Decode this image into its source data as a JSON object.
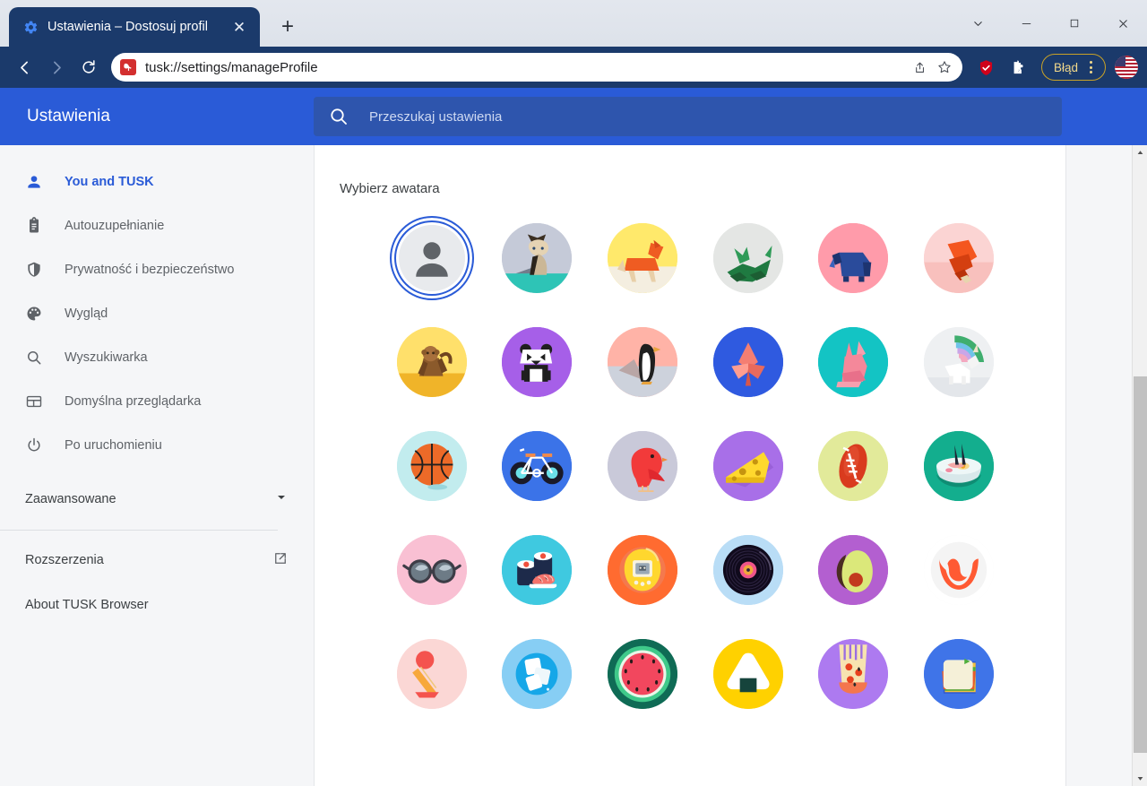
{
  "browser": {
    "tab": {
      "title": "Ustawienia – Dostosuj profil",
      "favicon": "gear-icon",
      "close_label": "✕"
    },
    "newtab_label": "+",
    "window_controls": {
      "more": "⌄",
      "minimize": "—",
      "maximize": "□",
      "close": "✕"
    },
    "toolbar": {
      "back": "back-arrow-icon",
      "forward": "forward-arrow-icon",
      "reload": "reload-icon",
      "url": "tusk://settings/manageProfile",
      "site_icon": "tusk-logo-icon",
      "share": "share-icon",
      "bookmark": "star-icon",
      "shield": "shield-icon",
      "extensions": "puzzle-piece-icon",
      "error_pill_label": "Błąd",
      "kebab": "three-dot-menu-icon",
      "profile_avatar": "us-flag-avatar"
    }
  },
  "settings": {
    "title": "Ustawienia",
    "search": {
      "placeholder": "Przeszukaj ustawienia",
      "icon": "search-icon"
    },
    "sidebar": {
      "items": [
        {
          "label": "You and TUSK",
          "icon": "person-icon",
          "active": true
        },
        {
          "label": "Autouzupełnianie",
          "icon": "clipboard-icon",
          "active": false
        },
        {
          "label": "Prywatność i bezpieczeństwo",
          "icon": "shield-icon",
          "active": false
        },
        {
          "label": "Wygląd",
          "icon": "palette-icon",
          "active": false
        },
        {
          "label": "Wyszukiwarka",
          "icon": "search-icon",
          "active": false
        },
        {
          "label": "Domyślna przeglądarka",
          "icon": "browser-window-icon",
          "active": false
        },
        {
          "label": "Po uruchomieniu",
          "icon": "power-icon",
          "active": false
        }
      ],
      "advanced": {
        "label": "Zaawansowane",
        "icon": "chevron-down-icon"
      },
      "extensions": {
        "label": "Rozszerzenia",
        "icon": "external-link-icon"
      },
      "about": {
        "label": "About TUSK Browser"
      }
    },
    "main": {
      "section_title": "Wybierz awatara",
      "avatars": [
        {
          "name": "default-person",
          "selected": true,
          "bg": "#e8eaed",
          "fg": "#5f6368"
        },
        {
          "name": "origami-cat",
          "selected": false,
          "bg": "#c5cad8",
          "fg": "#3d3226"
        },
        {
          "name": "origami-dog",
          "selected": false,
          "bg": "#ffe96b",
          "fg": "#ef5c22"
        },
        {
          "name": "origami-dragon",
          "selected": false,
          "bg": "#e4e6e4",
          "fg": "#1f7a41"
        },
        {
          "name": "origami-elephant",
          "selected": false,
          "bg": "#ff9baa",
          "fg": "#2a4b9b"
        },
        {
          "name": "origami-fox",
          "selected": false,
          "bg": "#fbd4d3",
          "fg": "#f4561f"
        },
        {
          "name": "origami-monkey",
          "selected": false,
          "bg": "#ffe06b",
          "fg": "#8b5a2b"
        },
        {
          "name": "origami-panda",
          "selected": false,
          "bg": "#a65fe8",
          "fg": "#1f1f1f"
        },
        {
          "name": "origami-penguin",
          "selected": false,
          "bg": "#ffb3a7",
          "fg": "#1f1f1f"
        },
        {
          "name": "origami-butterfly",
          "selected": false,
          "bg": "#2f5ae0",
          "fg": "#f47e72"
        },
        {
          "name": "origami-rabbit",
          "selected": false,
          "bg": "#13c4c4",
          "fg": "#f4889a"
        },
        {
          "name": "origami-unicorn",
          "selected": false,
          "bg": "#e8eaed",
          "fg": "#ffffff"
        },
        {
          "name": "basketball",
          "selected": false,
          "bg": "#c2ecee",
          "fg": "#ec6a28"
        },
        {
          "name": "bicycle",
          "selected": false,
          "bg": "#3b73e8",
          "fg": "#ffffff"
        },
        {
          "name": "red-bird",
          "selected": false,
          "bg": "#c9c9d9",
          "fg": "#f23a3a"
        },
        {
          "name": "cheese",
          "selected": false,
          "bg": "#a86fe8",
          "fg": "#ffd82e"
        },
        {
          "name": "american-football",
          "selected": false,
          "bg": "#e2ea9a",
          "fg": "#d93b1e"
        },
        {
          "name": "ramen-bowl",
          "selected": false,
          "bg": "#13ae8e",
          "fg": "#eef7f7"
        },
        {
          "name": "sunglasses",
          "selected": false,
          "bg": "#f9c0d3",
          "fg": "#3c3c46"
        },
        {
          "name": "sushi",
          "selected": false,
          "bg": "#3fc9e0",
          "fg": "#1d2a4a"
        },
        {
          "name": "tamagotchi",
          "selected": false,
          "bg": "#ff6b30",
          "fg": "#ffd72e"
        },
        {
          "name": "vinyl-record",
          "selected": false,
          "bg": "#b9ddf6",
          "fg": "#100a1c"
        },
        {
          "name": "avocado",
          "selected": false,
          "bg": "#b35fd0",
          "fg": "#dbe87a"
        },
        {
          "name": "croissant-smile",
          "selected": false,
          "bg": "#f4f4f4",
          "fg": "#ff5a33"
        },
        {
          "name": "ice-cream-cone",
          "selected": false,
          "bg": "#fbd7d5",
          "fg": "#f4534e"
        },
        {
          "name": "ice-cubes",
          "selected": false,
          "bg": "#87cef4",
          "fg": "#ffffff"
        },
        {
          "name": "watermelon",
          "selected": false,
          "bg": "#0f6b55",
          "fg": "#f2475e"
        },
        {
          "name": "onigiri",
          "selected": false,
          "bg": "#ffd100",
          "fg": "#ffffff"
        },
        {
          "name": "pizza-slice",
          "selected": false,
          "bg": "#ad7af0",
          "fg": "#f7e3b0"
        },
        {
          "name": "sandwich",
          "selected": false,
          "bg": "#3f74e8",
          "fg": "#f5f0d8"
        }
      ]
    }
  },
  "scrollbar": {
    "up_arrow": "scroll-up-arrow-icon",
    "down_arrow": "scroll-down-arrow-icon"
  }
}
